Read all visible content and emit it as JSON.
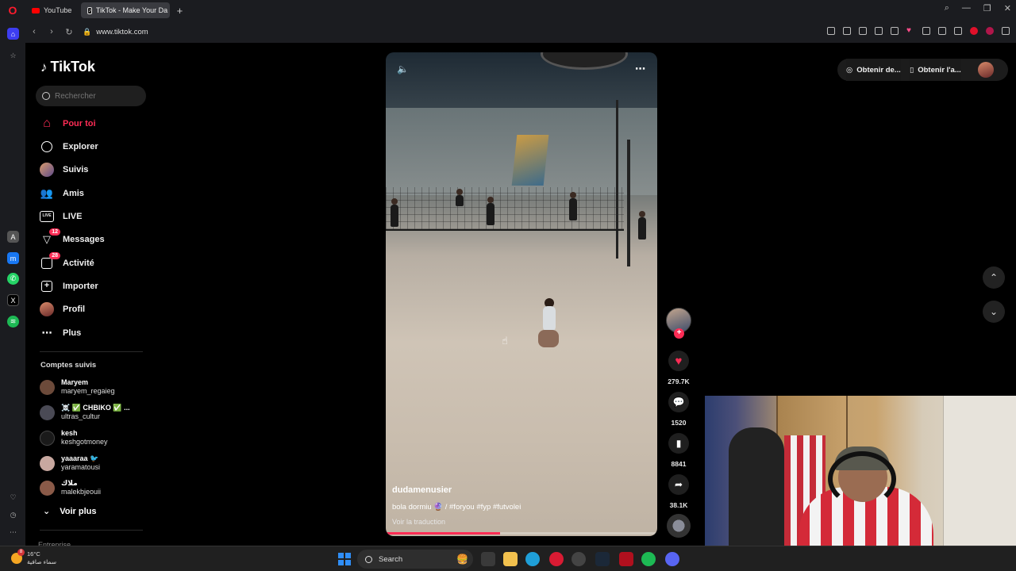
{
  "browser": {
    "tabs": [
      {
        "label": "YouTube"
      },
      {
        "label": "TikTok - Make Your Da"
      }
    ],
    "url": "www.tiktok.com"
  },
  "tiktok": {
    "logo": "TikTok",
    "search_placeholder": "Rechercher",
    "nav": [
      {
        "label": "Pour toi",
        "icon": "home-icon"
      },
      {
        "label": "Explorer",
        "icon": "compass-icon"
      },
      {
        "label": "Suivis",
        "icon": "following-avatar-icon"
      },
      {
        "label": "Amis",
        "icon": "friends-icon"
      },
      {
        "label": "LIVE",
        "icon": "live-icon"
      },
      {
        "label": "Messages",
        "icon": "messages-icon",
        "badge": "12"
      },
      {
        "label": "Activité",
        "icon": "activity-icon",
        "badge": "28"
      },
      {
        "label": "Importer",
        "icon": "upload-icon"
      },
      {
        "label": "Profil",
        "icon": "profile-avatar-icon"
      },
      {
        "label": "Plus",
        "icon": "more-icon"
      }
    ],
    "followed_title": "Comptes suivis",
    "followed": [
      {
        "name": "Maryem",
        "handle": "maryem_regaieg"
      },
      {
        "name": "☠️ ✅ CHBIKO ✅ ...",
        "handle": "ultras_cultur"
      },
      {
        "name": "kesh",
        "handle": "keshgotmoney"
      },
      {
        "name": "yaaaraa 🐦",
        "handle": "yaramatousi"
      },
      {
        "name": "ملاك",
        "handle": "malekbjeouii"
      }
    ],
    "voir_plus": "Voir plus",
    "entreprise": "Entreprise",
    "top_buttons": {
      "get_app_1": "Obtenir de...",
      "get_app_2": "Obtenir l'a..."
    }
  },
  "video": {
    "username": "dudamenusier",
    "description": "bola dormiu 🔮 / #foryou #fyp #futvolei",
    "translate": "Voir la traduction",
    "progress": 0.42,
    "likes": "279.7K",
    "comments": "1520",
    "saves": "8841",
    "shares": "38.1K"
  },
  "taskbar": {
    "temperature": "16°C",
    "weather_desc": "سماء صافية",
    "weather_badge": "8",
    "search_label": "Search"
  },
  "colors": {
    "accent": "#fe2c55",
    "background": "#000000"
  }
}
